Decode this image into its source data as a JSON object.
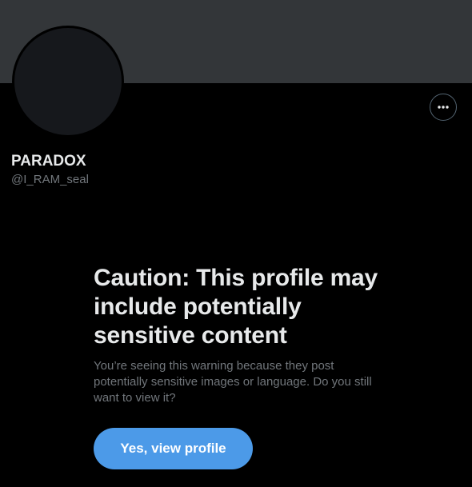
{
  "profile": {
    "display_name": "PARADOX",
    "handle": "@I_RAM_seal"
  },
  "warning": {
    "title": "Caution: This profile may include potentially sensitive content",
    "body": "You’re seeing this warning because they post potentially sensitive images or language. Do you still want to view it?",
    "button_label": "Yes, view profile"
  },
  "icons": {
    "more": "more-horizontal-icon"
  },
  "colors": {
    "background": "#000000",
    "banner": "#333639",
    "avatar": "#16181c",
    "primary_text": "#e7e9ea",
    "secondary_text": "#71767b",
    "accent": "#4c9ae8",
    "button_border": "#536471"
  }
}
